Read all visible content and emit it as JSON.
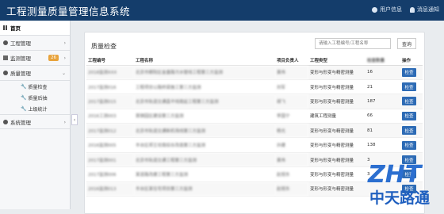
{
  "header": {
    "title": "工程测量质量管理信息系统",
    "user_info": "用户信息",
    "notice": "消息通知"
  },
  "sidebar": {
    "items": [
      {
        "label": "首页",
        "active": true
      },
      {
        "label": "工程管理",
        "arrow": "›"
      },
      {
        "label": "监测管理",
        "badge": "26",
        "arrow": "›"
      },
      {
        "label": "质量管理",
        "arrow": "⌄"
      }
    ],
    "subitems": [
      "质量检查",
      "质量后抽",
      "上级统计"
    ],
    "last_item": {
      "label": "系统管理",
      "arrow": "›"
    },
    "collapse": "‹"
  },
  "panel": {
    "title": "质量检查",
    "search_placeholder": "请输入工程编号/工程名称",
    "query_label": "查询",
    "columns": [
      "工程编号",
      "工程名称",
      "项目负责人",
      "工程类型",
      "检查数量",
      "操作"
    ],
    "rows": [
      {
        "id": "2018监测XXX",
        "name": "北京市朝阳区金盏路污水管线工程第三方监测",
        "lead": "黄伟",
        "type": "变形与形变与精密测量",
        "count": "16",
        "op": "检查"
      },
      {
        "id": "2017监测016",
        "name": "工程项目公路桥梁施工第三方监测",
        "lead": "刘军",
        "type": "变形与形变与精密测量",
        "count": "21",
        "op": "检查"
      },
      {
        "id": "2017监测015",
        "name": "北京市轨道交通昌平线南延工程第三方监测",
        "lead": "胡飞",
        "type": "变形与形变与精密测量",
        "count": "187",
        "op": "检查"
      },
      {
        "id": "2016工测003",
        "name": "首钢园区建设第三方监测",
        "lead": "李国宁",
        "type": "建筑工程测量",
        "count": "66",
        "op": "检查"
      },
      {
        "id": "2017监测012",
        "name": "北京市轨道交通新机场线第三方监测",
        "lead": "杨光",
        "type": "变形与形变与精密测量",
        "count": "81",
        "op": "检查"
      },
      {
        "id": "2016监测005",
        "name": "丰台区郑王坟南综合改造第三方监测",
        "lead": "孙建",
        "type": "变形与形变与精密测量",
        "count": "138",
        "op": "检查"
      },
      {
        "id": "2017监测001",
        "name": "北京市轨道交通工程第三方监测",
        "lead": "黄伟",
        "type": "变形与形变与精密测量",
        "count": "3",
        "op": "检查"
      },
      {
        "id": "2017监测006",
        "name": "某道路改建工程第三方监测",
        "lead": "赵旭东",
        "type": "变形与形变与精密测量",
        "count": "3",
        "op": "检查"
      },
      {
        "id": "2016监测013",
        "name": "丰台区某住宅项目第三方监测",
        "lead": "赵旭东",
        "type": "变形与形变与精密测量",
        "count": "",
        "op": "检查"
      }
    ]
  },
  "logo": {
    "text_top": "ZHT",
    "text_bottom": "中天路通"
  },
  "colors": {
    "header_bg": "#143d6b",
    "button_blue": "#2d6bb5",
    "badge": "#e8a33c"
  }
}
